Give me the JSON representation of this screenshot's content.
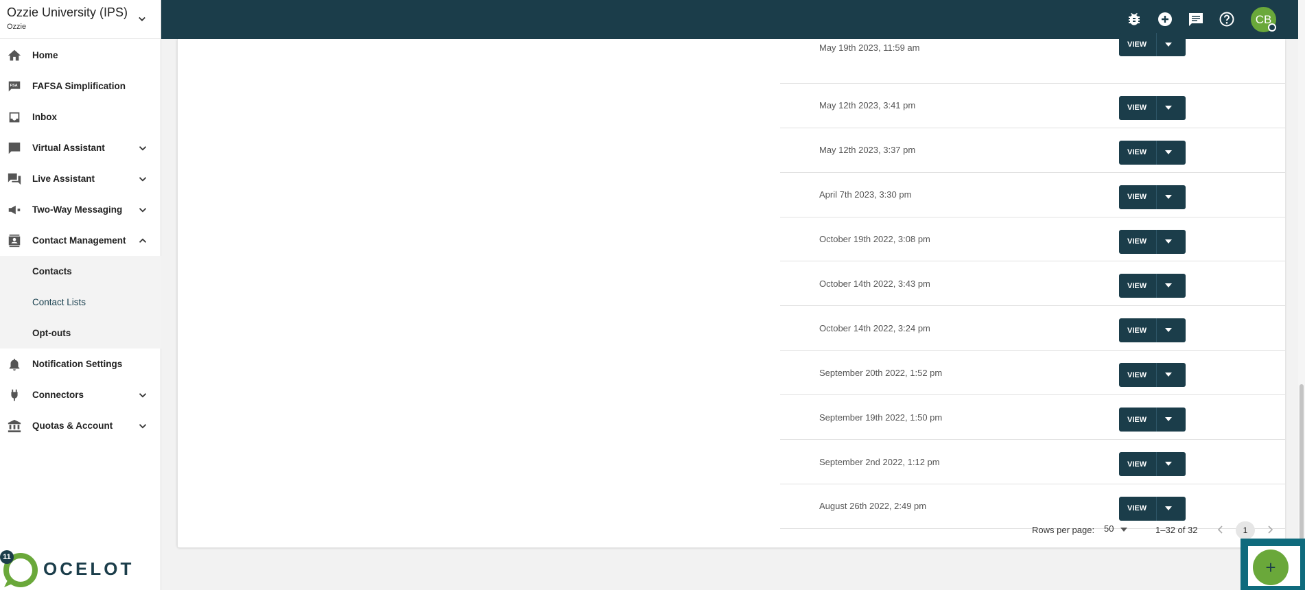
{
  "org": {
    "name": "Ozzie University (IPS)",
    "sub": "Ozzie"
  },
  "nav": {
    "items": [
      {
        "label": "Home"
      },
      {
        "label": "FAFSA Simplification"
      },
      {
        "label": "Inbox"
      },
      {
        "label": "Virtual Assistant"
      },
      {
        "label": "Live Assistant"
      },
      {
        "label": "Two-Way Messaging"
      },
      {
        "label": "Contact Management"
      }
    ],
    "sub_items": [
      {
        "label": "Contacts"
      },
      {
        "label": "Contact Lists"
      },
      {
        "label": "Opt-outs"
      }
    ],
    "lower_items": [
      {
        "label": "Notification Settings"
      },
      {
        "label": "Connectors"
      },
      {
        "label": "Quotas & Account"
      }
    ]
  },
  "logo": {
    "badge": "11",
    "text": "OCELOT"
  },
  "header": {
    "avatar_initials": "CB"
  },
  "table": {
    "button_label": "VIEW",
    "rows": [
      {
        "date": "May 19th 2023, 11:59 am"
      },
      {
        "date": "May 12th 2023, 3:41 pm"
      },
      {
        "date": "May 12th 2023, 3:37 pm"
      },
      {
        "date": "April 7th 2023, 3:30 pm"
      },
      {
        "date": "October 19th 2022, 3:08 pm"
      },
      {
        "date": "October 14th 2022, 3:43 pm"
      },
      {
        "date": "October 14th 2022, 3:24 pm"
      },
      {
        "date": "September 20th 2022, 1:52 pm"
      },
      {
        "date": "September 19th 2022, 1:50 pm"
      },
      {
        "date": "September 2nd 2022, 1:12 pm"
      },
      {
        "date": "August 26th 2022, 2:49 pm"
      }
    ]
  },
  "pagination": {
    "rows_per_page_label": "Rows per page:",
    "rows_per_page": "50",
    "range": "1–32 of 32",
    "page": "1"
  },
  "fab": {
    "label": "+"
  },
  "colors": {
    "primary": "#1b3d4a",
    "accent": "#6aa83a",
    "highlight": "#0f6b7d"
  }
}
